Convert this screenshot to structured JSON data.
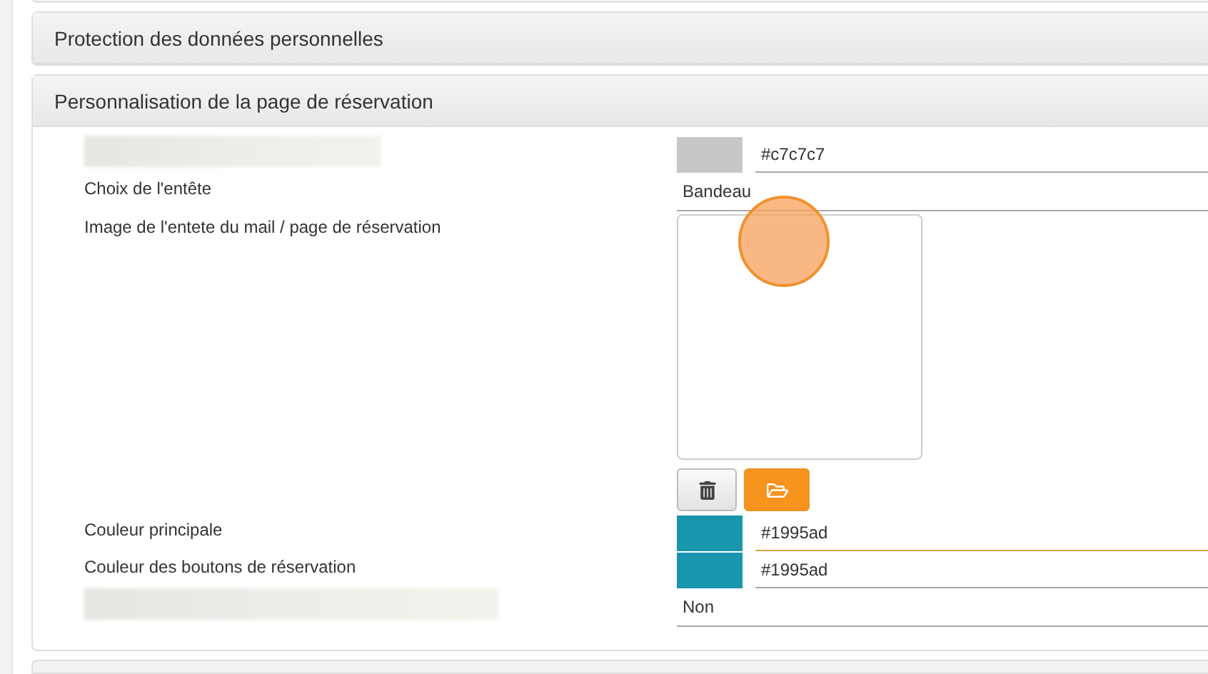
{
  "panels": [
    {
      "title": "Protection des données personnelles",
      "expanded": false
    },
    {
      "title": "Personnalisation de la page de réservation",
      "expanded": true
    }
  ],
  "fields": [
    {
      "kind": "color",
      "label_blurred": true,
      "value": "#c7c7c7",
      "color": "#c7c7c7",
      "focused": false
    },
    {
      "kind": "select",
      "label": "Choix de l'entête",
      "value": "Bandeau"
    },
    {
      "kind": "image",
      "label": "Image de l'entete du mail / page de réservation"
    },
    {
      "kind": "color",
      "label": "Couleur principale",
      "value": "#1995ad",
      "color": "#1995ad",
      "focused": true
    },
    {
      "kind": "color",
      "label": "Couleur des boutons de réservation",
      "value": "#1995ad",
      "color": "#1995ad",
      "focused": false
    },
    {
      "kind": "select",
      "label_blurred": true,
      "value": "Non"
    }
  ]
}
